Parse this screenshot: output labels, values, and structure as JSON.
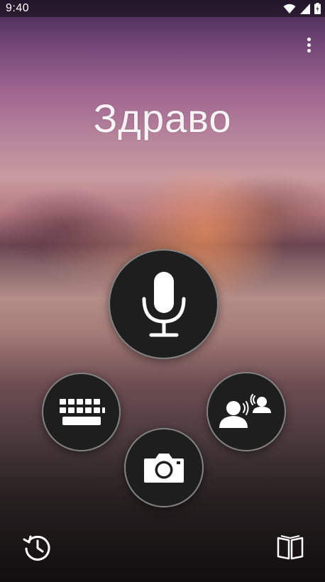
{
  "status_bar": {
    "time": "9:40",
    "icons": [
      "wifi-icon",
      "cellular-signal-icon",
      "battery-icon"
    ]
  },
  "toolbar": {
    "overflow_icon": "more-vert-icon"
  },
  "main": {
    "greeting": "Здраво"
  },
  "actions": {
    "voice": "microphone-icon",
    "keyboard": "keyboard-icon",
    "camera": "camera-icon",
    "conversation": "conversation-icon"
  },
  "bottom_bar": {
    "history": "history-icon",
    "phrasebook": "phrasebook-icon"
  },
  "colors": {
    "button_fill": "#1e1e1e",
    "button_border": "rgba(255,255,255,0.45)",
    "icon": "#ffffff"
  }
}
